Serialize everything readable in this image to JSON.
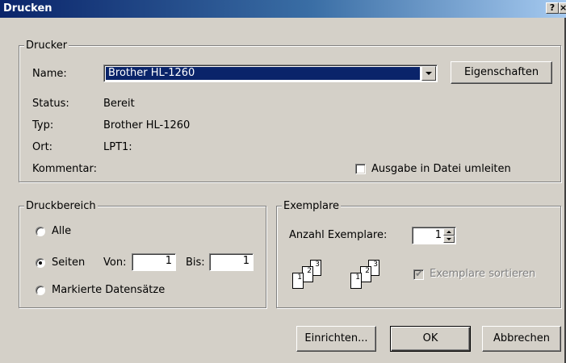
{
  "window": {
    "title": "Drucken",
    "help_button": "?",
    "close_button": "×"
  },
  "printer_group": {
    "label": "Drucker",
    "name_label": "Name:",
    "name_value": "Brother HL-1260",
    "properties_button": "Eigenschaften",
    "status_label": "Status:",
    "status_value": "Bereit",
    "type_label": "Typ:",
    "type_value": "Brother HL-1260",
    "location_label": "Ort:",
    "location_value": "LPT1:",
    "comment_label": "Kommentar:",
    "print_to_file_label": "Ausgabe in Datei umleiten",
    "print_to_file_checked": false
  },
  "range_group": {
    "label": "Druckbereich",
    "all_label": "Alle",
    "pages_label": "Seiten",
    "from_label": "Von:",
    "from_value": "1",
    "to_label": "Bis:",
    "to_value": "1",
    "selection_label": "Markierte Datensätze",
    "selected_option": "Seiten"
  },
  "copies_group": {
    "label": "Exemplare",
    "count_label": "Anzahl Exemplare:",
    "count_value": "1",
    "collate_label": "Exemplare sortieren",
    "collate_checked": true,
    "collate_enabled": false,
    "collate_icon_pages": [
      "1",
      "2",
      "3"
    ]
  },
  "footer": {
    "setup_button": "Einrichten...",
    "ok_button": "OK",
    "cancel_button": "Abbrechen"
  },
  "colors": {
    "dialog_face": "#d4d0c8",
    "titlebar_start": "#0a246a",
    "titlebar_end": "#a6caf0",
    "selection": "#0a246a"
  }
}
